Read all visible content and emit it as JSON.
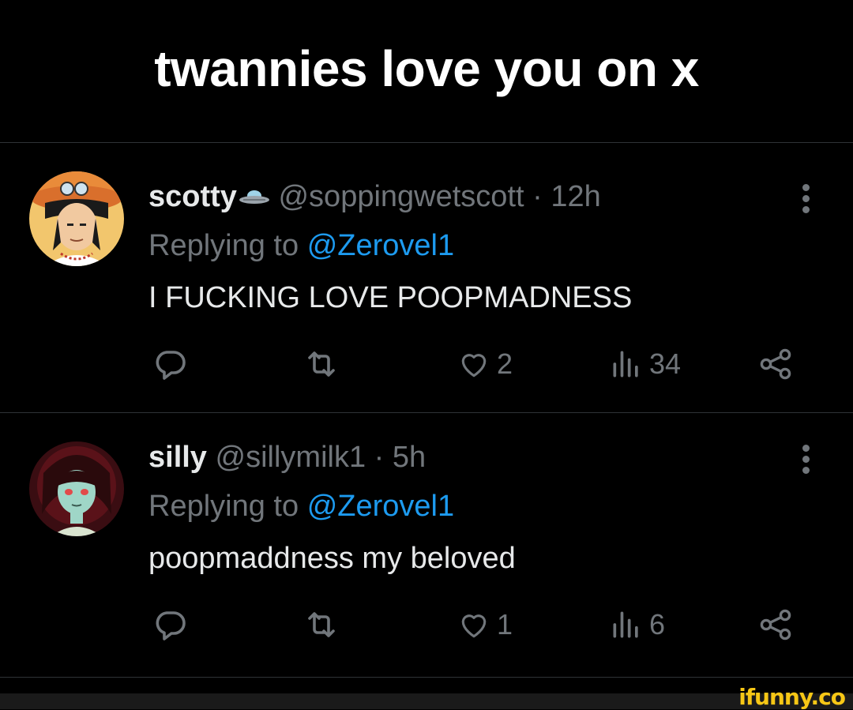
{
  "meme": {
    "title": "twannies love you on x"
  },
  "tweets": [
    {
      "display_name": "scotty",
      "badge_icon": "ufo-icon",
      "handle": "@soppingwetscott",
      "separator": "·",
      "time": "12h",
      "replying_prefix": "Replying to",
      "replying_to": "@Zerovel1",
      "text": "I FUCKING LOVE POOPMADNESS",
      "likes": "2",
      "views": "34"
    },
    {
      "display_name": "silly",
      "badge_icon": "",
      "handle": "@sillymilk1",
      "separator": "·",
      "time": "5h",
      "replying_prefix": "Replying to",
      "replying_to": "@Zerovel1",
      "text": "poopmaddness my beloved",
      "likes": "1",
      "views": "6"
    }
  ],
  "icons": {
    "reply": "reply-icon",
    "retweet": "retweet-icon",
    "like": "heart-icon",
    "views": "views-chart-icon",
    "share": "share-icon",
    "more": "more-vertical-icon"
  },
  "colors": {
    "background": "#000000",
    "text": "#e7e9ea",
    "secondary": "#71767b",
    "mention": "#1d9bf0",
    "divider": "#2f3336",
    "watermark": "#f7c716"
  },
  "watermark": "ifunny.co"
}
